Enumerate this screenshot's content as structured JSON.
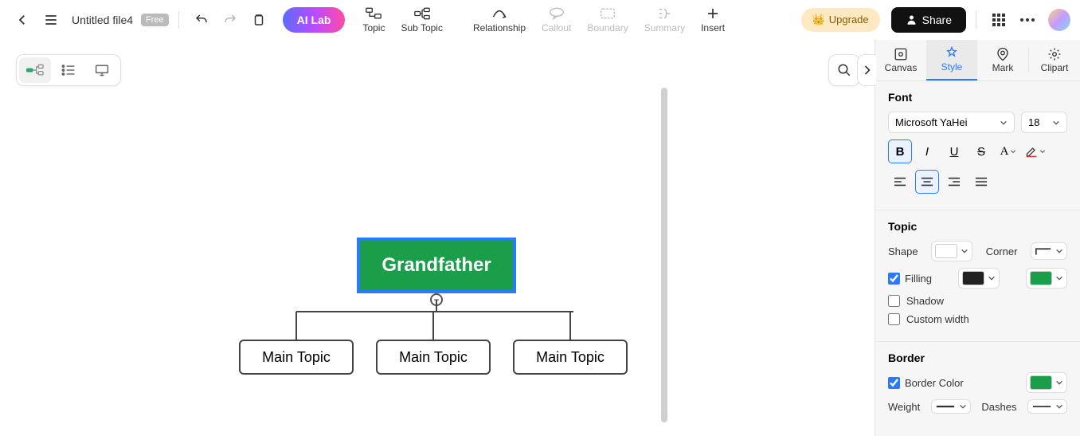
{
  "toolbar": {
    "file_name": "Untitled file4",
    "free_badge": "Free",
    "ai_lab": "AI Lab",
    "items": {
      "topic": "Topic",
      "subtopic": "Sub Topic",
      "relationship": "Relationship",
      "callout": "Callout",
      "boundary": "Boundary",
      "summary": "Summary",
      "insert": "Insert"
    },
    "upgrade": "Upgrade",
    "share": "Share"
  },
  "mindmap": {
    "root": "Grandfather",
    "children": [
      "Main Topic",
      "Main Topic",
      "Main Topic"
    ],
    "collapse_glyph": "−"
  },
  "panel": {
    "tabs": {
      "canvas": "Canvas",
      "style": "Style",
      "mark": "Mark",
      "clipart": "Clipart"
    },
    "font": {
      "title": "Font",
      "family": "Microsoft YaHei",
      "size": "18"
    },
    "topic": {
      "title": "Topic",
      "shape_label": "Shape",
      "corner_label": "Corner",
      "filling_label": "Filling",
      "shadow_label": "Shadow",
      "custom_width_label": "Custom width",
      "filling_checked": true,
      "shadow_checked": false,
      "custom_width_checked": false,
      "fill_color1": "#222222",
      "fill_color2": "#1a9e4a"
    },
    "border": {
      "title": "Border",
      "color_label": "Border Color",
      "color_checked": true,
      "color": "#1a9e4a",
      "weight_label": "Weight",
      "dashes_label": "Dashes"
    }
  }
}
